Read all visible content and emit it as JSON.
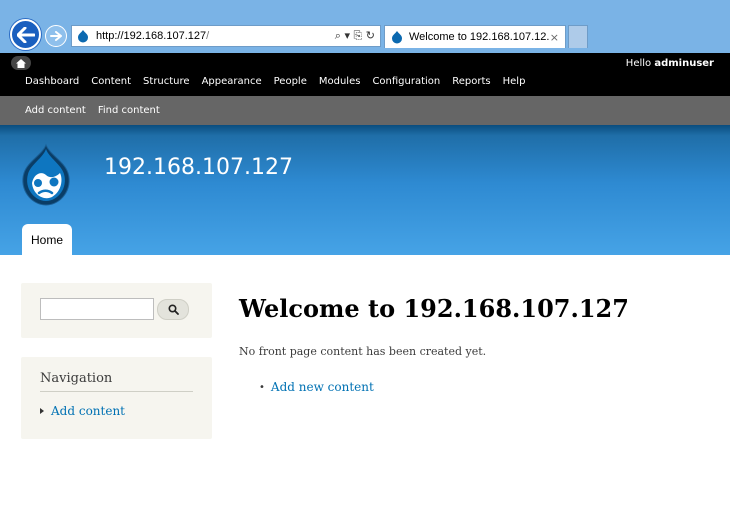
{
  "browser": {
    "url_host": "http://192.168.107.127",
    "url_rest": "/",
    "tab_title": "Welcome to 192.168.107.12...",
    "tab_close": "×",
    "address_tools": "⌕ ▾ ⎘ ↻"
  },
  "toolbar": {
    "greeting_prefix": "Hello ",
    "username": "adminuser",
    "menu": [
      "Dashboard",
      "Content",
      "Structure",
      "Appearance",
      "People",
      "Modules",
      "Configuration",
      "Reports",
      "Help"
    ],
    "shortcuts": [
      "Add content",
      "Find content"
    ]
  },
  "header": {
    "site_name": "192.168.107.127",
    "home_tab": "Home"
  },
  "sidebar": {
    "search_placeholder": "",
    "navigation_title": "Navigation",
    "navigation_link": "Add content"
  },
  "main": {
    "title": "Welcome to 192.168.107.127",
    "intro": "No front page content has been created yet.",
    "link": "Add new content"
  },
  "colors": {
    "link": "#0071b3",
    "header_blue": "#2e8ad2",
    "toolbar_black": "#000000",
    "shortcut_gray": "#666666",
    "sidebar_bg": "#f6f5ef"
  }
}
